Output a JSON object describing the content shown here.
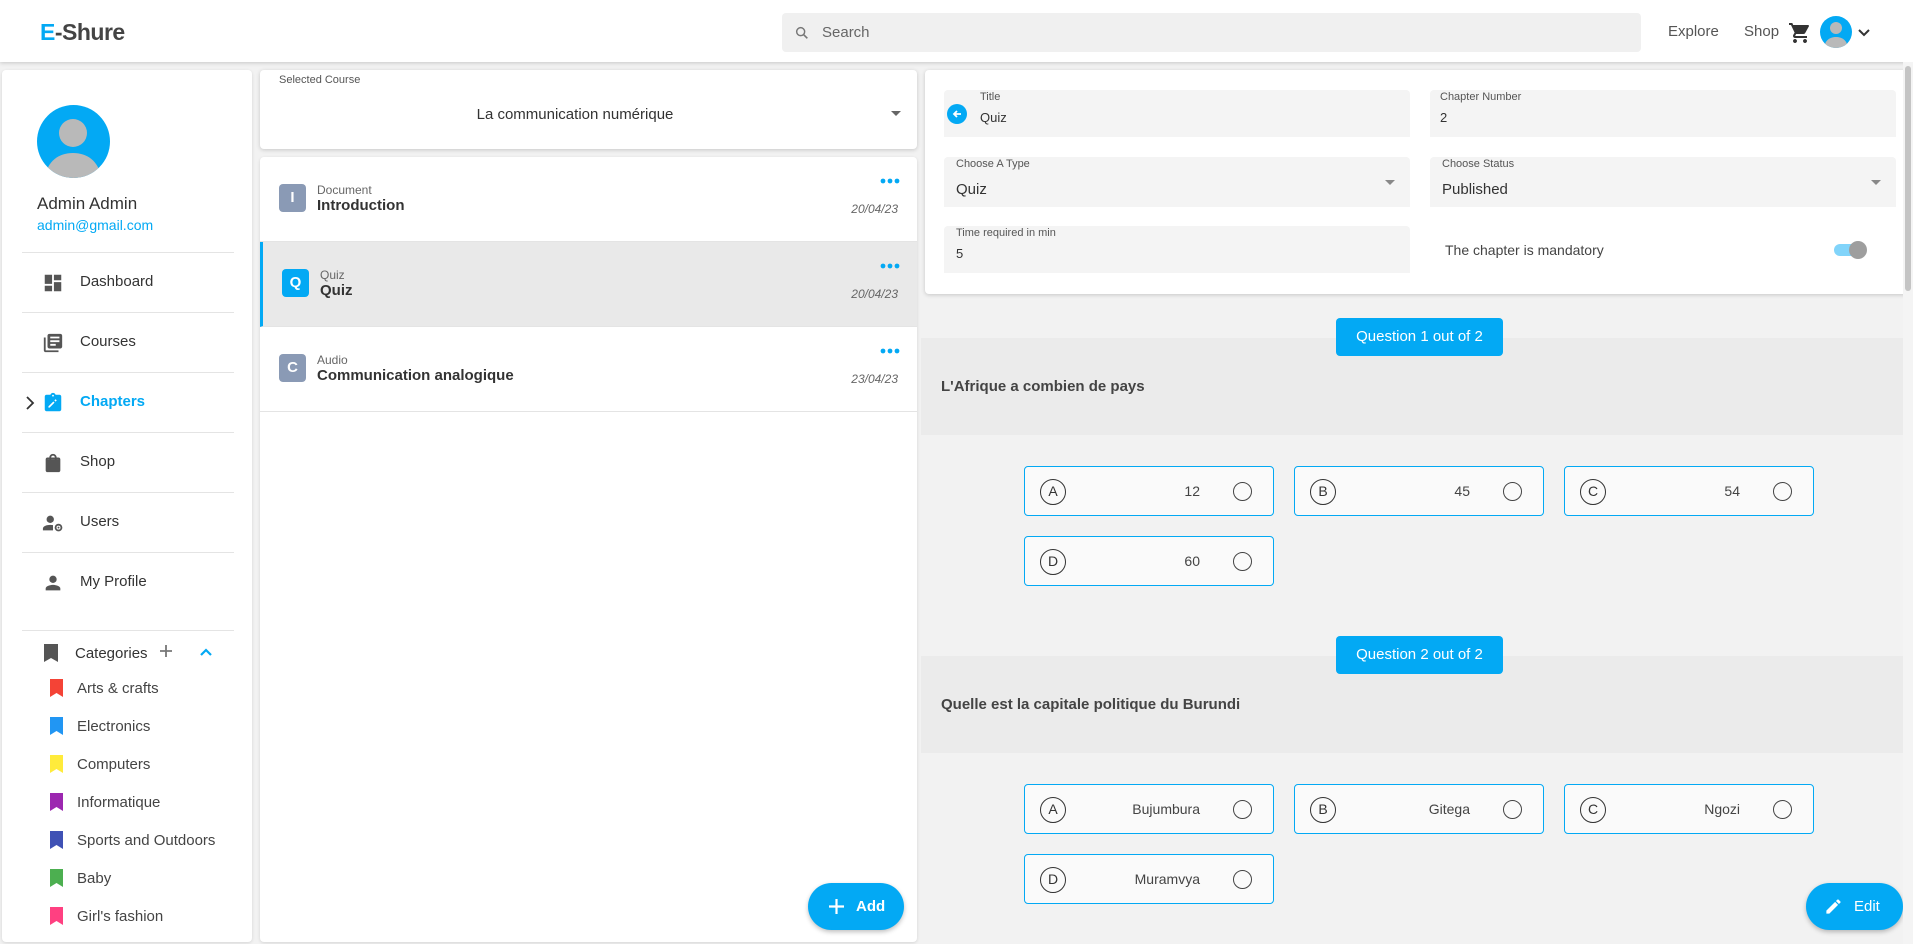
{
  "app": {
    "logo_prefix": "E",
    "logo_rest": "-Shure",
    "search_placeholder": "Search",
    "nav": [
      "Explore",
      "Shop"
    ]
  },
  "sidebar": {
    "user_name": "Admin Admin",
    "user_email": "admin@gmail.com",
    "items": [
      {
        "label": "Dashboard",
        "icon": "dashboard-icon"
      },
      {
        "label": "Courses",
        "icon": "library-books-icon"
      },
      {
        "label": "Chapters",
        "icon": "assignment-edit-icon",
        "active": true
      },
      {
        "label": "Shop",
        "icon": "shopping-bag-icon"
      },
      {
        "label": "Users",
        "icon": "manage-accounts-icon"
      },
      {
        "label": "My Profile",
        "icon": "person-icon"
      }
    ],
    "categories_label": "Categories",
    "categories": [
      {
        "label": "Arts & crafts",
        "color": "#f44336"
      },
      {
        "label": "Electronics",
        "color": "#2196f3"
      },
      {
        "label": "Computers",
        "color": "#ffeb3b"
      },
      {
        "label": "Informatique",
        "color": "#9c27b0"
      },
      {
        "label": "Sports and Outdoors",
        "color": "#3f51b5"
      },
      {
        "label": "Baby",
        "color": "#4caf50"
      },
      {
        "label": "Girl's fashion",
        "color": "#ff4081"
      }
    ]
  },
  "course_select": {
    "label": "Selected Course",
    "value": "La communication numérique"
  },
  "chapters": [
    {
      "badge": "I",
      "type": "Document",
      "title": "Introduction",
      "date": "20/04/23",
      "selected": false
    },
    {
      "badge": "Q",
      "type": "Quiz",
      "title": "Quiz",
      "date": "20/04/23",
      "selected": true
    },
    {
      "badge": "C",
      "type": "Audio",
      "title": "Communication analogique",
      "date": "23/04/23",
      "selected": false
    }
  ],
  "add_label": "Add",
  "form": {
    "title_label": "Title",
    "title_value": "Quiz",
    "chapter_number_label": "Chapter Number",
    "chapter_number_value": "2",
    "type_label": "Choose A Type",
    "type_value": "Quiz",
    "status_label": "Choose Status",
    "status_value": "Published",
    "time_label": "Time required in min",
    "time_value": "5",
    "mandatory_label": "The chapter is mandatory",
    "mandatory_on": true
  },
  "questions": [
    {
      "pill": "Question 1 out of 2",
      "text": "L'Afrique a combien de pays",
      "options": [
        {
          "letter": "A",
          "text": "12"
        },
        {
          "letter": "B",
          "text": "45"
        },
        {
          "letter": "C",
          "text": "54"
        },
        {
          "letter": "D",
          "text": "60"
        }
      ]
    },
    {
      "pill": "Question 2 out of 2",
      "text": "Quelle est la capitale politique du Burundi",
      "options": [
        {
          "letter": "A",
          "text": "Bujumbura"
        },
        {
          "letter": "B",
          "text": "Gitega"
        },
        {
          "letter": "C",
          "text": "Ngozi"
        },
        {
          "letter": "D",
          "text": "Muramvya"
        }
      ]
    }
  ],
  "edit_label": "Edit",
  "colors": {
    "accent": "#03a9f4"
  }
}
